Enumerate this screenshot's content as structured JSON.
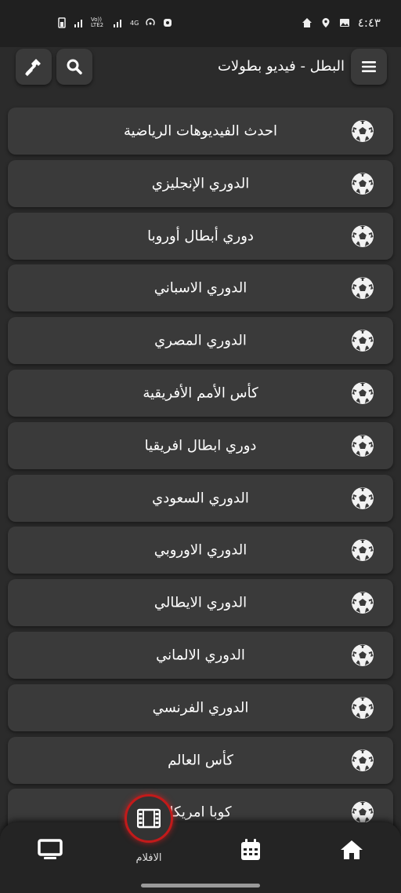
{
  "status_bar": {
    "time": "٤:٤٣",
    "network": "Vo)) LTE2",
    "network_type": "4G"
  },
  "app_bar": {
    "title": "البطل - فيديو بطولات",
    "menu_icon": "menu-icon",
    "search_icon": "search-icon",
    "tools_icon": "hammer-icon"
  },
  "list": {
    "items": [
      {
        "label": "احدث الفيديوهات الرياضية"
      },
      {
        "label": "الدوري الإنجليزي"
      },
      {
        "label": "دوري أبطال أوروبا"
      },
      {
        "label": "الدوري الاسباني"
      },
      {
        "label": "الدوري المصري"
      },
      {
        "label": "كأس الأمم الأفريقية"
      },
      {
        "label": "دوري ابطال افريقيا"
      },
      {
        "label": "الدوري السعودي"
      },
      {
        "label": "الدوري الاوروبي"
      },
      {
        "label": "الدوري الايطالي"
      },
      {
        "label": "الدوري الالماني"
      },
      {
        "label": "الدوري الفرنسي"
      },
      {
        "label": "كأس العالم"
      },
      {
        "label": "كوبا امريكا"
      }
    ],
    "icon": "soccer-ball-icon"
  },
  "bottom_nav": {
    "films_label": "الافلام",
    "accent": "#c21a1a"
  }
}
